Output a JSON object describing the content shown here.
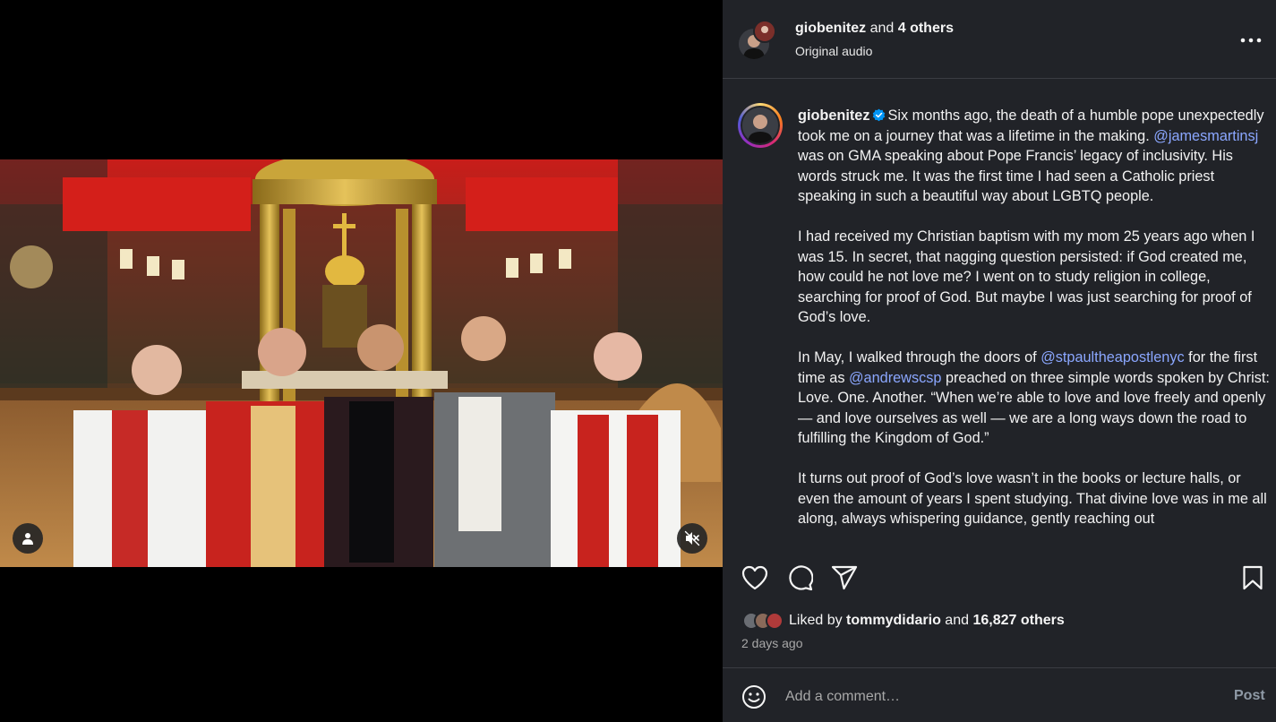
{
  "header": {
    "username": "giobenitez",
    "and_text": "and",
    "others": "4 others",
    "audio": "Original audio",
    "more_icon": "more-horizontal-icon"
  },
  "caption": {
    "username": "giobenitez",
    "verified_icon": "verified-badge-icon",
    "paragraphs": [
      {
        "before": "Six months ago, the death of a humble pope unexpectedly took me on a journey that was a lifetime in the making. ",
        "mention1": "@jamesmartinsj",
        "after1": " was on GMA speaking about Pope Francis’ legacy of inclusivity. His words struck me. It was the first time I had seen a Catholic priest speaking in such a beautiful way about LGBTQ people."
      },
      {
        "text": "I had received my Christian baptism with my mom 25 years ago when I was 15. In secret, that nagging question persisted: if God created me, how could he not love me? I went on to study religion in college, searching for proof of God. But maybe I was just searching for proof of God’s love."
      },
      {
        "before": "In May, I walked through the doors of ",
        "mention1": "@stpaultheapostlenyc",
        "middle": " for the first time as ",
        "mention2": "@andrewscsp",
        "after": " preached on three simple words spoken by Christ: Love. One. Another. “When we’re able to love and love freely and openly — and love ourselves as well — we are a long ways down the road to fulfilling the Kingdom of God.”"
      },
      {
        "text": "It turns out proof of God’s love wasn’t in the books or lecture halls, or even the amount of years I spent studying. That divine love was in me all along, always whispering guidance, gently reaching out"
      }
    ]
  },
  "actions": {
    "like_icon": "heart-icon",
    "comment_icon": "comment-icon",
    "share_icon": "share-icon",
    "save_icon": "bookmark-icon"
  },
  "likes": {
    "prefix": "Liked by",
    "user": "tommydidario",
    "and_text": "and",
    "count": "16,827 others"
  },
  "timestamp": "2 days ago",
  "comment": {
    "placeholder": "Add a comment…",
    "post_label": "Post",
    "emoji_icon": "emoji-icon"
  },
  "media": {
    "tag_icon": "user-tag-icon",
    "mute_icon": "muted-speaker-icon"
  },
  "colors": {
    "panel_bg": "#212328",
    "link": "#8ba7ff",
    "muted_text": "#a8a8a8"
  }
}
